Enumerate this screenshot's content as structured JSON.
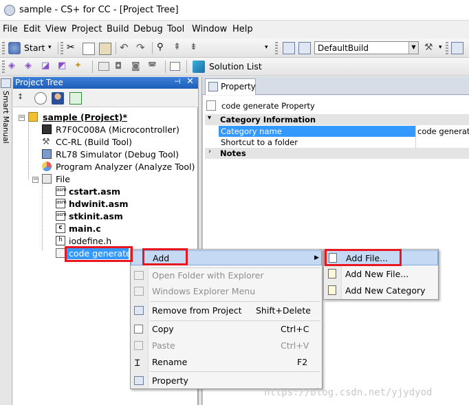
{
  "window": {
    "title": "sample - CS+ for CC - [Project Tree]"
  },
  "menubar": [
    "File",
    "Edit",
    "View",
    "Project",
    "Build",
    "Debug",
    "Tool",
    "Window",
    "Help"
  ],
  "toolbar": {
    "start_label": "Start",
    "build_config": "DefaultBuild",
    "solution_list_label": "Solution List"
  },
  "side_tab": {
    "label": "Smart Manual"
  },
  "project_tree": {
    "title": "Project Tree",
    "pin_glyph": "⊣",
    "close_glyph": "✕",
    "root": "sample (Project)*",
    "nodes": [
      "R7F0C008A (Microcontroller)",
      "CC-RL (Build Tool)",
      "RL78 Simulator (Debug Tool)",
      "Program Analyzer (Analyze Tool)",
      "File"
    ],
    "files": [
      "cstart.asm",
      "hdwinit.asm",
      "stkinit.asm",
      "main.c",
      "iodefine.h"
    ],
    "selected": "code generate"
  },
  "property_panel": {
    "tab_label": "Property",
    "subject": "code generate Property",
    "section_category": "Category Information",
    "row_category_name": "Category name",
    "row_category_value": "code generate",
    "row_shortcut": "Shortcut to a folder",
    "section_notes": "Notes"
  },
  "context_menu": {
    "add": "Add",
    "open_folder": "Open Folder with Explorer",
    "windows_explorer_menu": "Windows Explorer Menu",
    "remove": "Remove from Project",
    "remove_shortcut": "Shift+Delete",
    "copy": "Copy",
    "copy_shortcut": "Ctrl+C",
    "paste": "Paste",
    "paste_shortcut": "Ctrl+V",
    "rename": "Rename",
    "rename_shortcut": "F2",
    "property": "Property"
  },
  "submenu": {
    "add_file": "Add File...",
    "add_new_file": "Add New File...",
    "add_new_category": "Add New Category"
  },
  "watermark": "https://blog.csdn.net/yjydyod",
  "colors": {
    "selection": "#3399ff",
    "highlight": "#c5d9f5",
    "red_annotation": "#e8161f",
    "title_blue": "#1f5eb9"
  }
}
